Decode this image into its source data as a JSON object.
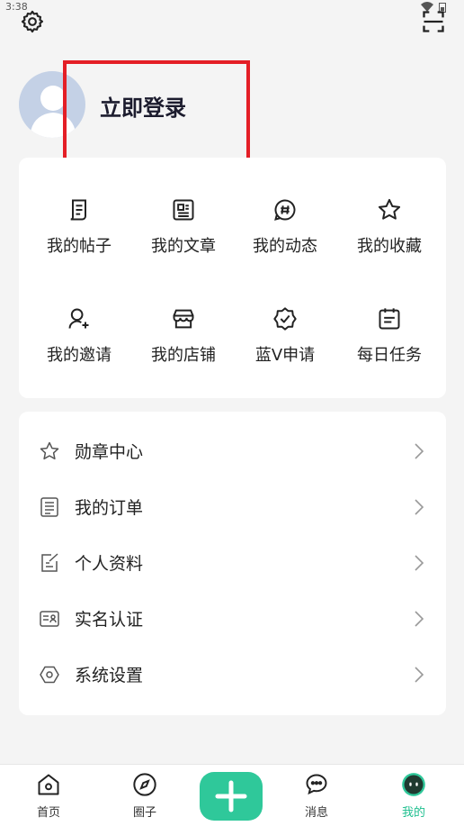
{
  "status_bar": {
    "time": "3:38"
  },
  "profile": {
    "login_label": "立即登录"
  },
  "grid": [
    {
      "label": "我的帖子",
      "icon": "post-icon"
    },
    {
      "label": "我的文章",
      "icon": "article-icon"
    },
    {
      "label": "我的动态",
      "icon": "hashtag-icon"
    },
    {
      "label": "我的收藏",
      "icon": "star-icon"
    },
    {
      "label": "我的邀请",
      "icon": "invite-user-icon"
    },
    {
      "label": "我的店铺",
      "icon": "store-icon"
    },
    {
      "label": "蓝V申请",
      "icon": "verified-badge-icon"
    },
    {
      "label": "每日任务",
      "icon": "calendar-icon"
    }
  ],
  "list": [
    {
      "label": "勋章中心",
      "icon": "star-outline-icon"
    },
    {
      "label": "我的订单",
      "icon": "order-list-icon"
    },
    {
      "label": "个人资料",
      "icon": "edit-profile-icon"
    },
    {
      "label": "实名认证",
      "icon": "id-card-icon"
    },
    {
      "label": "系统设置",
      "icon": "hexagon-settings-icon"
    }
  ],
  "nav": [
    {
      "label": "首页",
      "icon": "home-icon"
    },
    {
      "label": "圈子",
      "icon": "compass-icon"
    },
    {
      "label": "消息",
      "icon": "chat-icon"
    },
    {
      "label": "我的",
      "icon": "me-face-icon"
    }
  ],
  "colors": {
    "accent": "#2fc89a",
    "highlight": "#e41e26",
    "avatar_bg": "#c4d1e6"
  }
}
